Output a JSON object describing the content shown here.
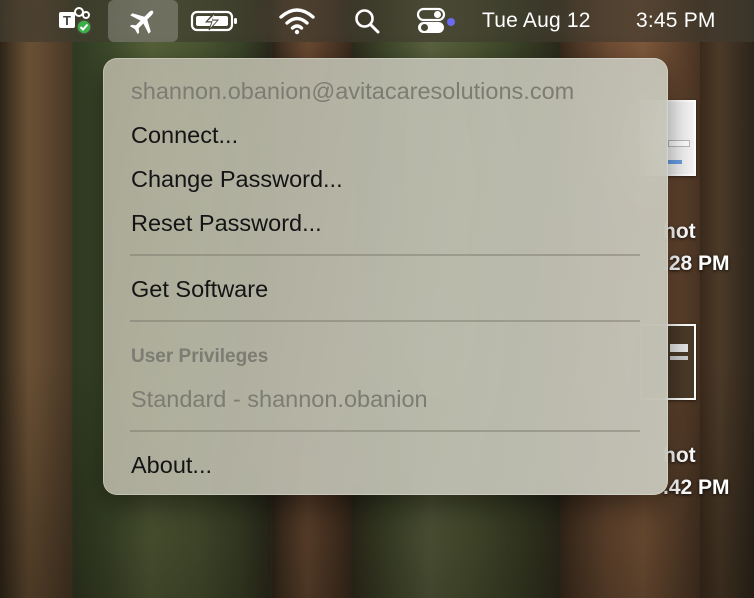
{
  "menubar": {
    "icons": [
      {
        "name": "teams-icon",
        "status": "available-checkmark"
      },
      {
        "name": "airplane-icon",
        "active": true
      },
      {
        "name": "battery-charging-icon"
      },
      {
        "name": "wifi-icon"
      },
      {
        "name": "search-icon"
      },
      {
        "name": "control-center-icon"
      }
    ],
    "date": "Tue Aug 12",
    "time": "3:45 PM"
  },
  "menu": {
    "account": "shannon.obanion@avitacaresolutions.com",
    "connect": "Connect...",
    "change_password": "Change Password...",
    "reset_password": "Reset Password...",
    "get_software": "Get Software",
    "privileges_header": "User Privileges",
    "privileges_value": "Standard - shannon.obanion",
    "about": "About..."
  },
  "desktop": {
    "items": [
      {
        "label_line1": "hot",
        "label_line2": ".28 PM"
      },
      {
        "label_line1": "hot",
        "label_line2": ".42 PM"
      }
    ]
  },
  "colors": {
    "menu_text": "#141414",
    "menu_disabled": "#7d7c72",
    "focus_dot": "#6b6bf0",
    "teams_badge": "#3bb04a"
  }
}
